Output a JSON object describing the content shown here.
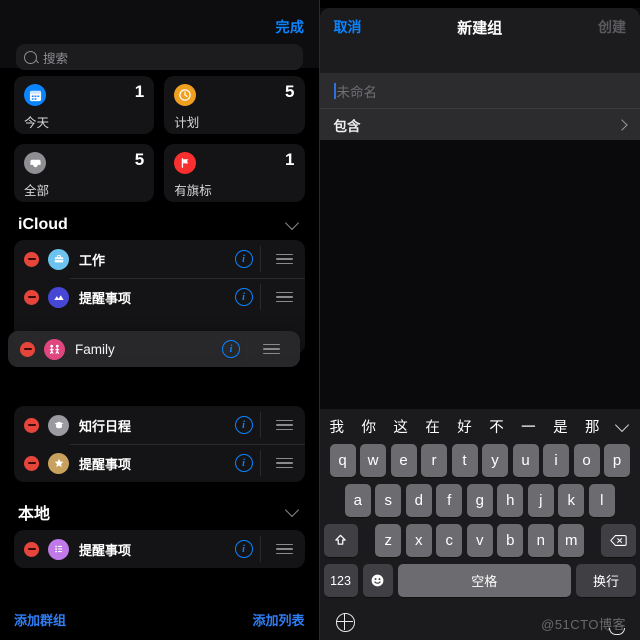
{
  "left_pane": {
    "done_label": "完成",
    "search": {
      "placeholder": "搜索",
      "icon": "search-icon"
    },
    "smart_lists": [
      {
        "label": "今天",
        "count": "1",
        "icon": "calendar-icon",
        "color": "#0a84ff"
      },
      {
        "label": "计划",
        "count": "5",
        "icon": "clock-icon",
        "color": "#f0a020"
      },
      {
        "label": "全部",
        "count": "5",
        "icon": "inbox-icon",
        "color": "#8e8e93"
      },
      {
        "label": "有旗标",
        "count": "1",
        "icon": "flag-icon",
        "color": "#fa2f2f"
      }
    ],
    "sections": [
      {
        "title": "iCloud",
        "collapse_icon": "chevron-down-icon",
        "lists": [
          {
            "label": "工作",
            "icon": "briefcase-icon",
            "color": "#6cc3f0"
          },
          {
            "label": "提醒事项",
            "icon": "mountains-icon",
            "color": "#4747d6"
          }
        ]
      },
      {
        "title": "",
        "collapse_icon": "",
        "lists": [
          {
            "label": "知行日程",
            "icon": "graduation-cap-icon",
            "color": "#9a9aa0"
          },
          {
            "label": "提醒事项",
            "icon": "star-icon",
            "color": "#c9a15e"
          }
        ]
      },
      {
        "title": "本地",
        "collapse_icon": "chevron-down-icon",
        "lists": [
          {
            "label": "提醒事项",
            "icon": "bullet-list-icon",
            "color": "#c07ae8"
          }
        ]
      }
    ],
    "dragging_row": {
      "label": "Family",
      "icon": "family-icon",
      "color": "#e0477f"
    },
    "row_controls": {
      "delete_icon": "minus-circle-icon",
      "info_icon": "info-circle-icon",
      "reorder_icon": "reorder-grip-icon"
    },
    "bottom": {
      "add_group": "添加群组",
      "add_list": "添加列表"
    }
  },
  "right_pane": {
    "nav": {
      "cancel": "取消",
      "title": "新建组",
      "create": "创建"
    },
    "name_field": {
      "placeholder": "未命名",
      "value": ""
    },
    "include_row": {
      "label": "包含",
      "chevron_icon": "chevron-right-icon"
    },
    "keyboard": {
      "suggestions": [
        "我",
        "你",
        "这",
        "在",
        "好",
        "不",
        "一",
        "是",
        "那"
      ],
      "collapse_icon": "chevron-down-icon",
      "row1": [
        "q",
        "w",
        "e",
        "r",
        "t",
        "y",
        "u",
        "i",
        "o",
        "p"
      ],
      "row2": [
        "a",
        "s",
        "d",
        "f",
        "g",
        "h",
        "j",
        "k",
        "l"
      ],
      "row3": [
        "z",
        "x",
        "c",
        "v",
        "b",
        "n",
        "m"
      ],
      "shift_icon": "shift-arrow-icon",
      "backspace_icon": "backspace-icon",
      "numbers_key": "123",
      "emoji_key": "emoji-icon",
      "space_key": "空格",
      "return_key": "换行",
      "globe_icon": "globe-icon",
      "mic_icon": "microphone-icon"
    }
  },
  "watermark": "@51CTO博客"
}
